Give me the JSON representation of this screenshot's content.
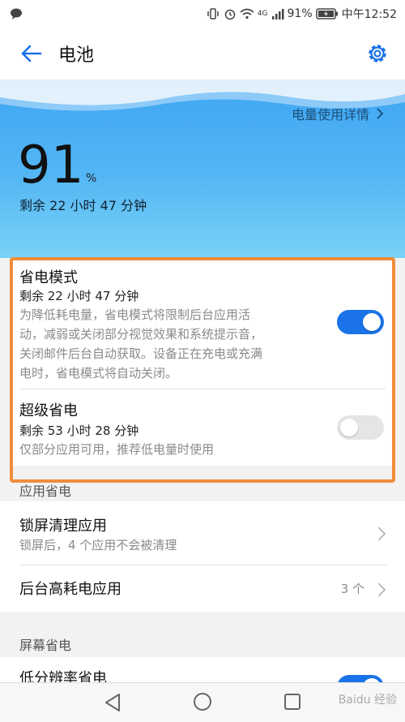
{
  "statusbar": {
    "battery_percent": "91%",
    "time": "中午12:52",
    "net": "4G"
  },
  "appbar": {
    "title": "电池"
  },
  "hero": {
    "details_label": "电量使用详情",
    "level": "91",
    "unit": "%",
    "remaining": "剩余 22 小时 47 分钟"
  },
  "power_saving": {
    "title": "省电模式",
    "remaining": "剩余 22 小时 47 分钟",
    "desc_lines": [
      "为降低耗电量，省电模式将限制后台应用活",
      "动，减弱或关闭部分视觉效果和系统提示音，",
      "关闭邮件后台自动获取。设备正在充电或充满",
      "电时，省电模式将自动关闭。"
    ],
    "enabled": true
  },
  "ultra_saving": {
    "title": "超级省电",
    "remaining": "剩余 53 小时 28 分钟",
    "desc": "仅部分应用可用，推荐低电量时使用",
    "enabled": false
  },
  "app_saving": {
    "header": "应用省电",
    "lock_clean": {
      "title": "锁屏清理应用",
      "subtitle": "锁屏后，4 个应用不会被清理"
    },
    "high_drain": {
      "title": "后台高耗电应用",
      "value": "3 个"
    }
  },
  "screen_saving": {
    "header": "屏幕省电",
    "low_res": {
      "title": "低分辨率省电"
    }
  },
  "watermark": "Baidu 经验",
  "colors": {
    "accent": "#1a73e8",
    "highlight": "#ef8d3a",
    "hero_top": "#3ea5f3",
    "hero_bottom": "#79d1f6"
  }
}
